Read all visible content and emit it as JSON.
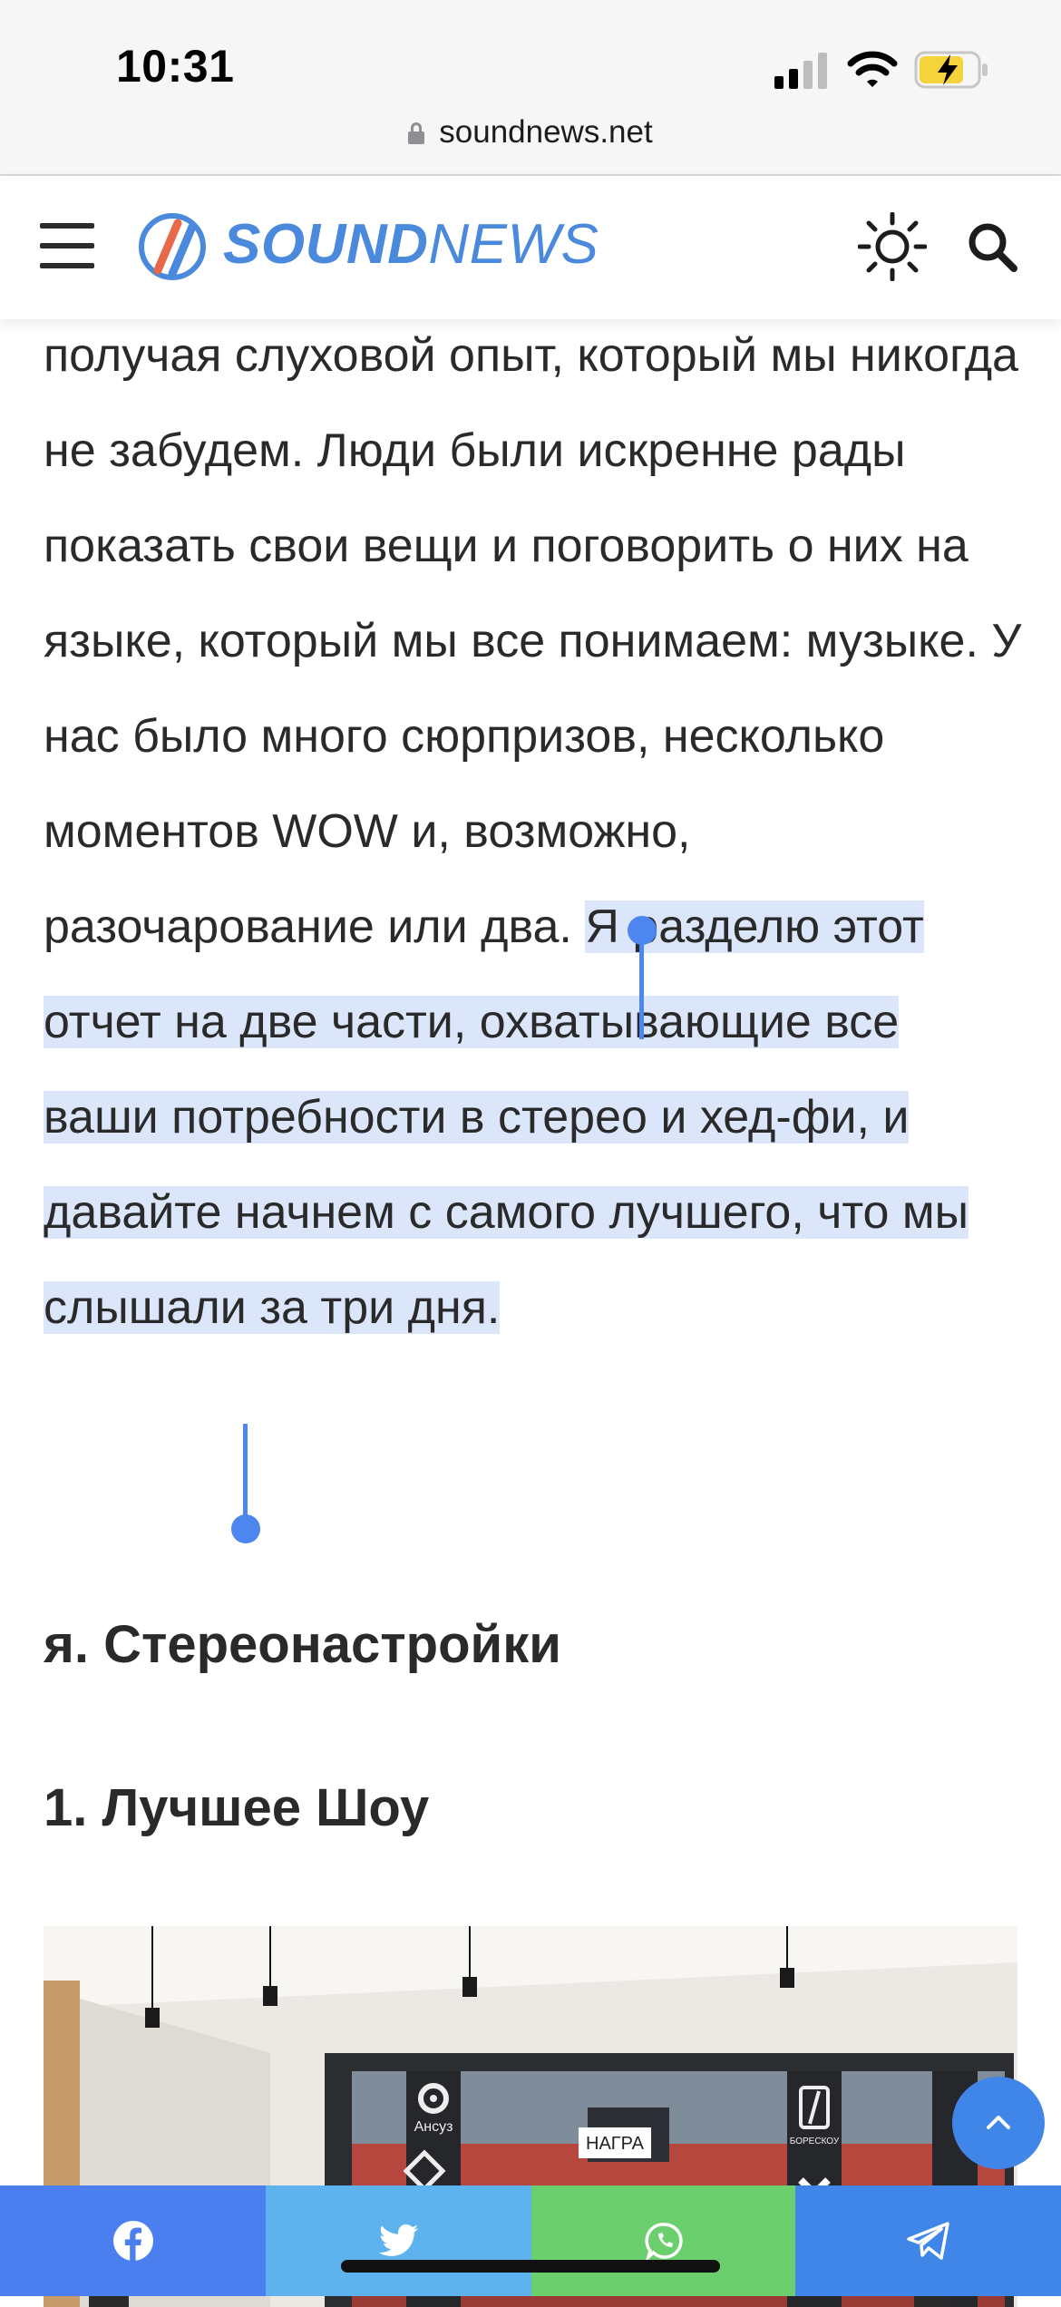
{
  "status_bar": {
    "time": "10:31"
  },
  "url_bar": {
    "domain": "soundnews.net"
  },
  "header": {
    "logo_sound": "SOUND",
    "logo_news": "NEWS"
  },
  "article": {
    "paragraph_before_selection": "получая слуховой опыт, который мы никогда не забудем. Люди были искренне рады показать свои вещи и поговорить о них на языке, который мы все понимаем: музыке. У нас было много сюрпризов, несколько моментов WOW и, возможно, разочарование или два.",
    "paragraph_selected": "Я разделю этот отчет на две части, охватывающие все ваши потребности в стерео и хед-фи, и давайте начнем с самого лучшего, что мы слышали за три дня.",
    "heading_1": "я. Стереонастройки",
    "heading_2": "1. Лучшее Шоу"
  },
  "image_labels": {
    "brand_left": "Ансуз",
    "brand_center": "НАГРА",
    "brand_right": "БОРЕСКОУ"
  },
  "colors": {
    "accent": "#4a89dc",
    "selection": "#dbe6fb",
    "facebook": "#4b7ff0",
    "twitter": "#5eb3ee",
    "whatsapp": "#6ccf6e",
    "telegram": "#3f86e8"
  },
  "icons": [
    "lock-icon",
    "hamburger-icon",
    "logo-icon",
    "sun-icon",
    "search-icon",
    "chevron-up-icon",
    "facebook-icon",
    "twitter-icon",
    "whatsapp-icon",
    "telegram-icon"
  ]
}
